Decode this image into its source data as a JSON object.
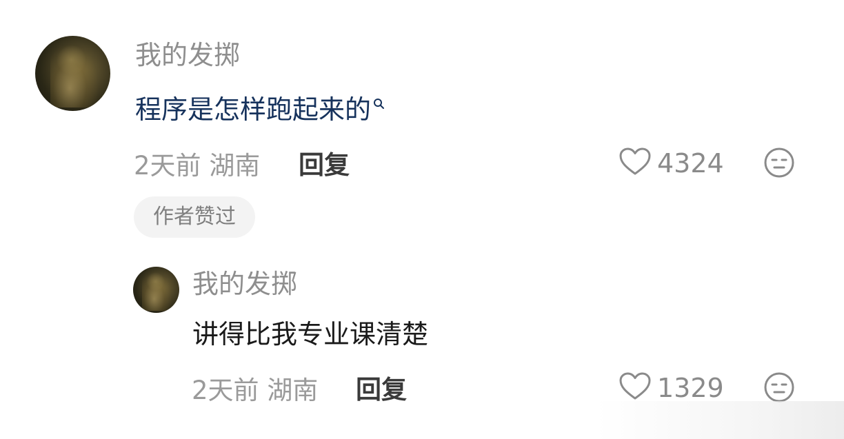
{
  "comments": [
    {
      "username": "我的发掷",
      "text": "程序是怎样跑起来的",
      "time": "2天前",
      "location": "湖南",
      "reply_label": "回复",
      "like_count": "4324",
      "badge": "作者赞过",
      "text_link_color": "#16325c"
    },
    {
      "username": "我的发掷",
      "text": "讲得比我专业课清楚",
      "time": "2天前",
      "location": "湖南",
      "reply_label": "回复",
      "like_count": "1329"
    }
  ],
  "icons": {
    "like": "heart-outline-icon",
    "dislike": "neutral-face-icon",
    "search": "search-icon"
  },
  "colors": {
    "username": "#8e8e8e",
    "meta": "#9a9a9a",
    "reply": "#3a3a3a",
    "badge_bg": "#f3f3f3"
  }
}
